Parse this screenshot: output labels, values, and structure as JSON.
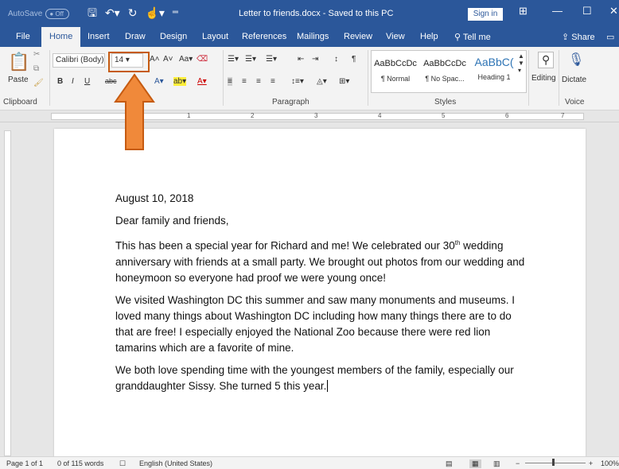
{
  "titlebar": {
    "autosave_label": "AutoSave",
    "autosave_state": "Off",
    "document_title": "Letter to friends.docx  -  Saved to this PC",
    "signin_label": "Sign in"
  },
  "tabs": [
    "File",
    "Home",
    "Insert",
    "Draw",
    "Design",
    "Layout",
    "References",
    "Mailings",
    "Review",
    "View",
    "Help"
  ],
  "active_tab": "Home",
  "tell_me": "Tell me",
  "share_label": "Share",
  "ribbon": {
    "clipboard": {
      "paste_label": "Paste",
      "group_label": "Clipboard"
    },
    "font": {
      "font_name": "Calibri (Body)",
      "font_size": "14",
      "bold": "B",
      "italic": "I",
      "underline": "U",
      "strike": "abc"
    },
    "paragraph": {
      "group_label": "Paragraph"
    },
    "styles": {
      "group_label": "Styles",
      "items": [
        {
          "preview": "AaBbCcDc",
          "name": "¶ Normal"
        },
        {
          "preview": "AaBbCcDc",
          "name": "¶ No Spac..."
        },
        {
          "preview": "AaBbC(",
          "name": "Heading 1"
        }
      ]
    },
    "editing_label": "Editing",
    "voice": {
      "dictate_label": "Dictate",
      "group_label": "Voice"
    }
  },
  "document": {
    "date": "August 10, 2018",
    "greeting": "Dear family and friends,",
    "p1_before": "This has been a special year for Richard and me! We celebrated our 30",
    "p1_sup": "th",
    "p1_after": " wedding anniversary with friends at a small party. We brought out photos from our wedding and honeymoon so everyone had proof we were young once!",
    "p2": "We visited Washington DC this summer and saw many monuments and museums. I loved many things about Washington DC including how many things there are to do that are free! I especially enjoyed the National Zoo because there were red lion tamarins which are a favorite of mine.",
    "p3": "We both love spending time with the youngest members of the family, especially our granddaughter Sissy. She turned 5 this year."
  },
  "statusbar": {
    "page": "Page 1 of 1",
    "words": "0 of 115 words",
    "language": "English (United States)",
    "zoom": "100%"
  },
  "ruler_numbers": [
    "1",
    "2",
    "3",
    "4",
    "5",
    "6",
    "7"
  ],
  "colors": {
    "brand": "#2b579a",
    "annotation": "#f0893a",
    "annotation_border": "#c65b11"
  }
}
